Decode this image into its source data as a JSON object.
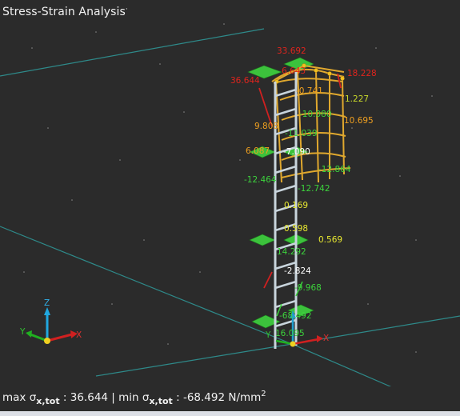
{
  "window": {
    "title": "Stress-Strain Analysis"
  },
  "axes_triad": {
    "z": "Z",
    "y": "Y",
    "x": "X"
  },
  "results": {
    "max_label": "max σ",
    "max_sub": "x,tot",
    "max_value": " : 36.644",
    "sep": " | ",
    "min_label": "min σ",
    "min_sub": "x,tot",
    "min_value": " : -68.492 N/mm",
    "unit_exp": "2"
  },
  "value_labels": [
    {
      "text": "33.692",
      "color": "#e0241d"
    },
    {
      "text": "6.643",
      "color": "#e0241d"
    },
    {
      "text": "18.228",
      "color": "#e0241d"
    },
    {
      "text": "36.644",
      "color": "#e0241d"
    },
    {
      "text": "-0.741",
      "color": "#f0a020"
    },
    {
      "text": "1.227",
      "color": "#c8d82a"
    },
    {
      "text": "-10.080",
      "color": "#3cd23c"
    },
    {
      "text": "10.695",
      "color": "#f0a020"
    },
    {
      "text": "9.808",
      "color": "#f0a020"
    },
    {
      "text": "-11.039",
      "color": "#3cd23c"
    },
    {
      "text": "6.087",
      "color": "#f0a020"
    },
    {
      "text": "-7.090",
      "color": "#ffffff"
    },
    {
      "text": "-12.864",
      "color": "#3cd23c"
    },
    {
      "text": "-12.464",
      "color": "#3cd23c"
    },
    {
      "text": "-12.742",
      "color": "#3cd23c"
    },
    {
      "text": "0.169",
      "color": "#e8e830"
    },
    {
      "text": "0.598",
      "color": "#e8e830"
    },
    {
      "text": "0.569",
      "color": "#e8e830"
    },
    {
      "text": "14.292",
      "color": "#3cd23c"
    },
    {
      "text": "-2.824",
      "color": "#ffffff"
    },
    {
      "text": "-9.968",
      "color": "#3cd23c"
    },
    {
      "text": "-68.492",
      "color": "#3cd23c"
    },
    {
      "text": "16.095",
      "color": "#3cd23c"
    }
  ]
}
